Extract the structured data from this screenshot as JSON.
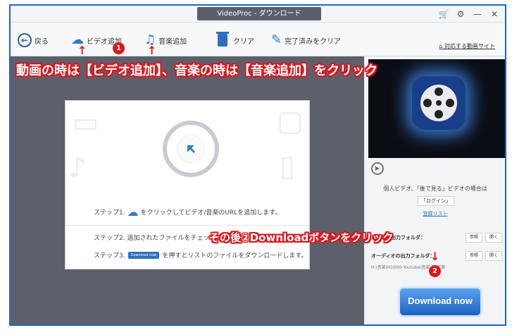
{
  "window": {
    "title": "VideoProc - ダウンロード",
    "controls": {
      "cart": "🛒",
      "settings": "⚙",
      "minimize": "—",
      "close": "✕"
    }
  },
  "toolbar": {
    "back_label": "戻る",
    "add_video_label": "ビデオ追加",
    "add_music_label": "音楽追加",
    "clear_label": "クリア",
    "clear_done_label": "完了済みをクリア",
    "supported_sites_label": "対応する動画サイト"
  },
  "panel": {
    "step1_prefix": "ステップ1.",
    "step1_text": "をクリックしてビデオ/音楽のURLを追加します。",
    "step2_text": "ステップ2. 追加されたファイルをチェックと設定",
    "step3_prefix": "ステップ3.",
    "step3_button": "Download now",
    "step3_text": "を押すとリストのファイルをダウンロードします。"
  },
  "right_panel": {
    "private_text": "個人ビデオ、「後で見る」ビデオの場合は",
    "login_button": "「ログイン」",
    "history_link": "登録リスト",
    "video_folder_label": "ビデオの出力フォルダ：",
    "music_folder_label": "オーディオの出力フォルダ：",
    "browse_label": "参照",
    "open_label": "開く",
    "path_text": "H:\\音楽(H)\\000-Youtube\\音楽 | P音源",
    "download_button": "Download now"
  },
  "annotations": {
    "main_caption": "動画の時は【ビデオ追加】、音楽の時は【音楽追加】をクリック",
    "step_caption": "その後②Downloadボタンをクリック",
    "marker1": "1",
    "marker2": "2",
    "arrow": "↑",
    "arrow_down": "↓",
    "color": "#e0151a"
  }
}
